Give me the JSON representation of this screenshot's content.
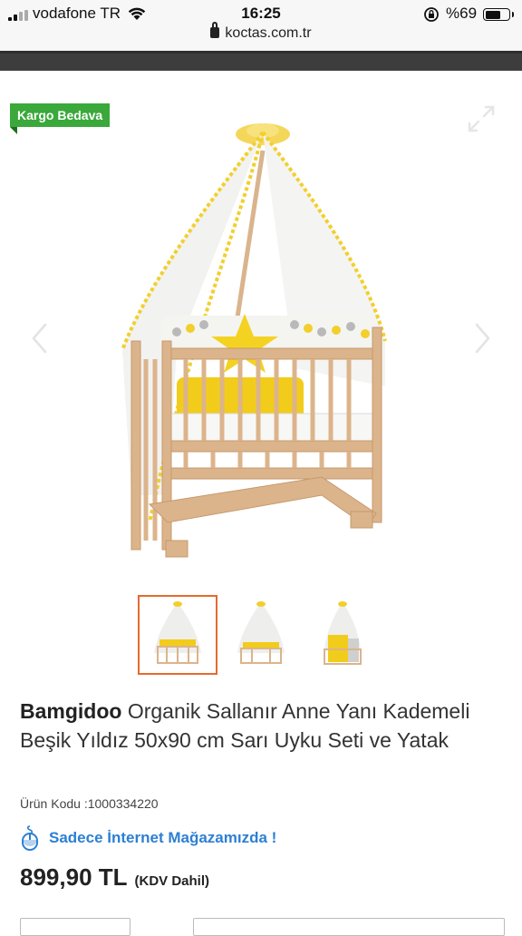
{
  "status_bar": {
    "carrier": "vodafone TR",
    "time": "16:25",
    "battery_pct": "%69",
    "battery_level": 0.69,
    "url": "koctas.com.tr"
  },
  "gallery": {
    "badge": "Kargo Bedava",
    "icons": [
      "expand-icon",
      "arrow-left-icon",
      "arrow-right-icon"
    ],
    "thumbnails_count": 3,
    "active_thumbnail": 0
  },
  "product": {
    "brand": "Bamgidoo",
    "name": " Organik Sallanır Anne Yanı Kademeli Beşik Yıldız 50x90 cm Sarı Uyku Seti ve Yatak",
    "code": "Ürün Kodu :1000334220",
    "internet_only": "Sadece İnternet Mağazamızda !",
    "price": "899,90 TL",
    "kdv": "(KDV Dahil)"
  },
  "colors": {
    "badge_green": "#3aa83a",
    "accent_orange": "#e46a2e",
    "link_blue": "#2d7fd3"
  }
}
